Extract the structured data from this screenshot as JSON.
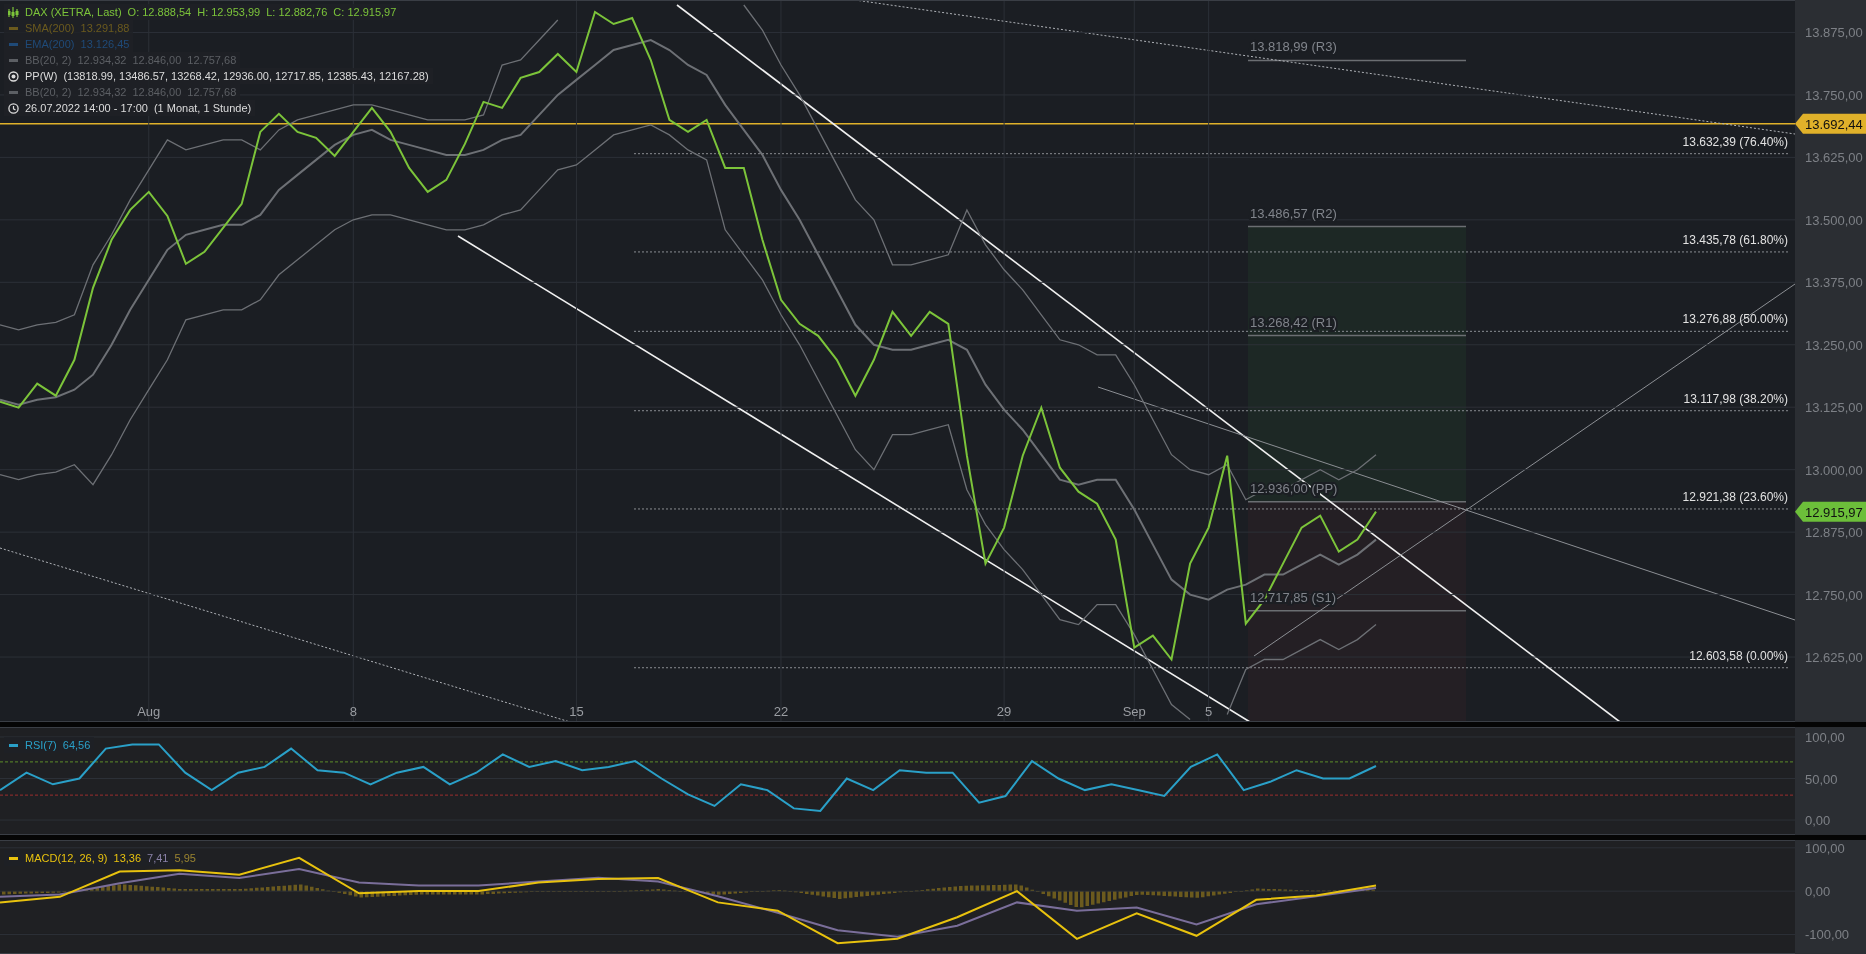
{
  "legend": [
    {
      "kind": "instrument",
      "values": [
        "O: 12.888,54",
        "H: 12.953,99",
        "L: 12.882,76",
        "C: 12.915,97"
      ],
      "color": "#7cc43a"
    },
    {
      "kind": "line",
      "name": "SMA(200)",
      "values": [
        "13.291,88"
      ],
      "color": "#6b5a1e"
    },
    {
      "kind": "line",
      "name": "EMA(200)",
      "values": [
        "13.126,45"
      ],
      "color": "#1f4a78"
    },
    {
      "kind": "line",
      "name": "BB(20, 2)",
      "values": [
        "12.934,32",
        "12.846,00",
        "12.757,68"
      ],
      "color": "#5c5f64"
    },
    {
      "kind": "pivot",
      "name": "PP(W)",
      "values": [
        "(13818.99, 13486.57, 13268.42, 12936.00, 12717.85, 12385.43, 12167.28)"
      ],
      "color": "#dcdcdc"
    },
    {
      "kind": "line",
      "name": "BB(20, 2)",
      "values": [
        "12.934,32",
        "12.846,00",
        "12.757,68"
      ],
      "color": "#5c5f64"
    },
    {
      "kind": "period",
      "name": "26.07.2022 14:00 - 17:00",
      "values": [
        "(1 Monat, 1 Stunde)"
      ],
      "color": "#dcdcdc"
    }
  ],
  "price_chart": {
    "chart_data": {
      "type": "line",
      "grid": true,
      "ylim": [
        12495,
        13940
      ],
      "categories": [
        null,
        null,
        null,
        null,
        null,
        null,
        null,
        null,
        "Aug",
        null,
        null,
        null,
        null,
        null,
        null,
        null,
        null,
        null,
        null,
        "8",
        null,
        null,
        null,
        null,
        null,
        null,
        null,
        null,
        null,
        null,
        null,
        "15",
        null,
        null,
        null,
        null,
        null,
        null,
        null,
        null,
        null,
        null,
        "22",
        null,
        null,
        null,
        null,
        null,
        null,
        null,
        null,
        null,
        null,
        null,
        "29",
        null,
        null,
        null,
        null,
        null,
        null,
        "Sep",
        null,
        null,
        null,
        "5",
        null,
        null,
        null,
        null,
        null,
        null,
        null,
        null,
        null
      ],
      "yticks": [
        {
          "value": 13875,
          "label": "13.875,00"
        },
        {
          "value": 13750,
          "label": "13.750,00"
        },
        {
          "value": 13625,
          "label": "13.625,00"
        },
        {
          "value": 13500,
          "label": "13.500,00"
        },
        {
          "value": 13375,
          "label": "13.375,00"
        },
        {
          "value": 13250,
          "label": "13.250,00"
        },
        {
          "value": 13125,
          "label": "13.125,00"
        },
        {
          "value": 13000,
          "label": "13.000,00"
        },
        {
          "value": 12875,
          "label": "12.875,00"
        },
        {
          "value": 12750,
          "label": "12.750,00"
        },
        {
          "value": 12625,
          "label": "12.625,00"
        }
      ],
      "series": [
        {
          "name": "DAX (XETRA, Last)",
          "color": "#7cc43a",
          "values": [
            13136,
            13124,
            13172,
            13148,
            13220,
            13364,
            13460,
            13520,
            13556,
            13508,
            13412,
            13436,
            13484,
            13532,
            13676,
            13712,
            13676,
            13664,
            13628,
            13676,
            13724,
            13676,
            13604,
            13556,
            13580,
            13652,
            13736,
            13724,
            13784,
            13796,
            13832,
            13796,
            13916,
            13892,
            13904,
            13820,
            13700,
            13676,
            13700,
            13604,
            13604,
            13460,
            13340,
            13292,
            13268,
            13220,
            13148,
            13220,
            13316,
            13268,
            13316,
            13292,
            13028,
            12812,
            12884,
            13028,
            13124,
            13004,
            12956,
            12932,
            12860,
            12644,
            12668,
            12620,
            12812,
            12884,
            13028,
            12692,
            12740,
            12812,
            12884,
            12908,
            12836,
            12860,
            12916
          ]
        },
        {
          "color": "#6d7075",
          "values": [
            13290,
            13280,
            13290,
            13295,
            13310,
            13410,
            13470,
            13540,
            13600,
            13660,
            13640,
            13650,
            13660,
            13660,
            13640,
            13680,
            13700,
            13710,
            13720,
            13730,
            13730,
            13720,
            13710,
            13700,
            13700,
            13700,
            13710,
            13810,
            13820,
            13860,
            13900,
            null,
            null,
            null,
            null,
            null,
            null,
            null,
            null,
            null,
            13930,
            13880,
            13810,
            13750,
            13680,
            13610,
            13540,
            13500,
            13410,
            13410,
            13420,
            13430,
            13520,
            13450,
            13400,
            13360,
            13310,
            13260,
            13250,
            13230,
            13230,
            13170,
            13100,
            13030,
            13000,
            12990,
            13010,
            12940,
            12960,
            12960,
            12980,
            13000,
            12980,
            13000,
            13030
          ]
        },
        {
          "color": "#6d7075",
          "values": [
            13140,
            13130,
            13140,
            13145,
            13160,
            13190,
            13250,
            13320,
            13380,
            13440,
            13470,
            13480,
            13490,
            13490,
            13510,
            13560,
            13590,
            13620,
            13650,
            13670,
            13680,
            13660,
            13650,
            13640,
            13630,
            13630,
            13640,
            13660,
            13670,
            13710,
            13750,
            13780,
            13810,
            13840,
            13850,
            13860,
            13840,
            13810,
            13790,
            13730,
            13680,
            13630,
            13560,
            13500,
            13430,
            13360,
            13290,
            13250,
            13240,
            13240,
            13250,
            13260,
            13240,
            13170,
            13120,
            13080,
            13030,
            12980,
            12970,
            12980,
            12980,
            12920,
            12850,
            12780,
            12750,
            12740,
            12760,
            12770,
            12790,
            12790,
            12810,
            12830,
            12810,
            12830,
            12860
          ]
        },
        {
          "color": "#6d7075",
          "values": [
            12990,
            12980,
            12990,
            12995,
            13010,
            12970,
            13030,
            13100,
            13160,
            13220,
            13300,
            13310,
            13320,
            13320,
            13340,
            13390,
            13420,
            13450,
            13480,
            13500,
            13510,
            13510,
            13500,
            13490,
            13480,
            13480,
            13490,
            13510,
            13520,
            13560,
            13600,
            13610,
            13640,
            13670,
            13680,
            13690,
            13670,
            13640,
            13620,
            13480,
            13430,
            13380,
            13310,
            13250,
            13180,
            13110,
            13040,
            13000,
            13070,
            13070,
            13080,
            13090,
            12960,
            12890,
            12840,
            12800,
            12750,
            12700,
            12690,
            12730,
            12730,
            12670,
            12600,
            12530,
            12500,
            null,
            12510,
            12600,
            12620,
            12620,
            12640,
            12660,
            12640,
            12660,
            12690
          ]
        }
      ]
    },
    "fib_levels": [
      {
        "label": "13.632,39 (76.40%)"
      },
      {
        "label": "13.435,78 (61.80%)"
      },
      {
        "label": "13.276,88 (50.00%)"
      },
      {
        "label": "13.117,98 (38.20%)"
      },
      {
        "label": "12.921,38 (23.60%)"
      },
      {
        "label": "12.603,58 (0.00%)"
      }
    ],
    "pivot_levels": [
      {
        "label": "13.818,99 (R3)"
      },
      {
        "label": "13.486,57 (R2)"
      },
      {
        "label": "13.268,42 (R1)"
      },
      {
        "label": "12.936,00 (PP)"
      },
      {
        "label": "12.717,85 (S1)"
      }
    ],
    "price_tags": [
      {
        "label": "13.692,44",
        "color": "#e0b12a"
      },
      {
        "label": "12.915,97",
        "color": "#6cbf3a"
      }
    ]
  },
  "rsi_panel": {
    "legend": {
      "value": "64,56",
      "color": "#2aa0c8"
    },
    "chart_data": {
      "type": "line",
      "grid": true,
      "ylim": [
        -18,
        112
      ],
      "categories": [
        null,
        null,
        null,
        null,
        null,
        null,
        null,
        null,
        null,
        null,
        null,
        null,
        null,
        null,
        null,
        null,
        null,
        null,
        null,
        null,
        null,
        null,
        null,
        null,
        null,
        null,
        null,
        null,
        null,
        null,
        null,
        null,
        null,
        null,
        null,
        null,
        null,
        null,
        null,
        null,
        null,
        null,
        null,
        null,
        null,
        null,
        null,
        null,
        null,
        null,
        null,
        null,
        null
      ],
      "yticks": [
        {
          "value": 100,
          "label": "100,00"
        },
        {
          "value": 50,
          "label": "50,00"
        },
        {
          "value": 0,
          "label": "0,00"
        }
      ],
      "series": [
        {
          "name": "RSI(7)",
          "color": "#2aa0c8",
          "values": [
            36,
            57,
            43,
            50,
            86,
            91,
            91,
            57,
            36,
            57,
            64,
            86,
            60,
            57,
            43,
            57,
            64,
            43,
            57,
            79,
            64,
            71,
            60,
            64,
            71,
            50,
            31,
            17,
            43,
            36,
            14,
            11,
            50,
            36,
            60,
            57,
            57,
            21,
            29,
            71,
            50,
            36,
            43,
            36,
            29,
            64,
            79,
            36,
            46,
            60,
            50,
            50,
            65
          ]
        }
      ]
    }
  },
  "macd_panel": {
    "legend": [
      {
        "text": "13,36",
        "color": "#e8c20e"
      },
      {
        "text": "7,41",
        "color": "#8a82a8"
      },
      {
        "text": "5,95",
        "color": "#9a8430"
      }
    ],
    "chart_data": {
      "type": "line",
      "grid": true,
      "ylim": [
        -145,
        118
      ],
      "categories": [
        null,
        null,
        null,
        null,
        null,
        null,
        null,
        null,
        null,
        null,
        null,
        null,
        null,
        null,
        null,
        null,
        null,
        null,
        null,
        null,
        null,
        null,
        null,
        null
      ],
      "yticks": [
        {
          "value": 100,
          "label": "100,00"
        },
        {
          "value": 0,
          "label": "0,00"
        },
        {
          "value": -100,
          "label": "-100,00"
        }
      ],
      "series": [
        {
          "name": "MACD(12, 26, 9)",
          "color": "#e8c20e",
          "values": [
            -26,
            -13,
            45,
            48,
            38,
            77,
            -5,
            0,
            0,
            20,
            28,
            30,
            -26,
            -45,
            -120,
            -110,
            -60,
            0,
            -110,
            -51,
            -103,
            -20,
            -10,
            13
          ]
        },
        {
          "color": "#7a6e9a",
          "values": [
            -13,
            -8,
            18,
            40,
            30,
            51,
            20,
            13,
            13,
            22,
            31,
            22,
            -12,
            -50,
            -90,
            -105,
            -80,
            -26,
            -45,
            -38,
            -77,
            -30,
            -12,
            7
          ]
        }
      ]
    }
  }
}
